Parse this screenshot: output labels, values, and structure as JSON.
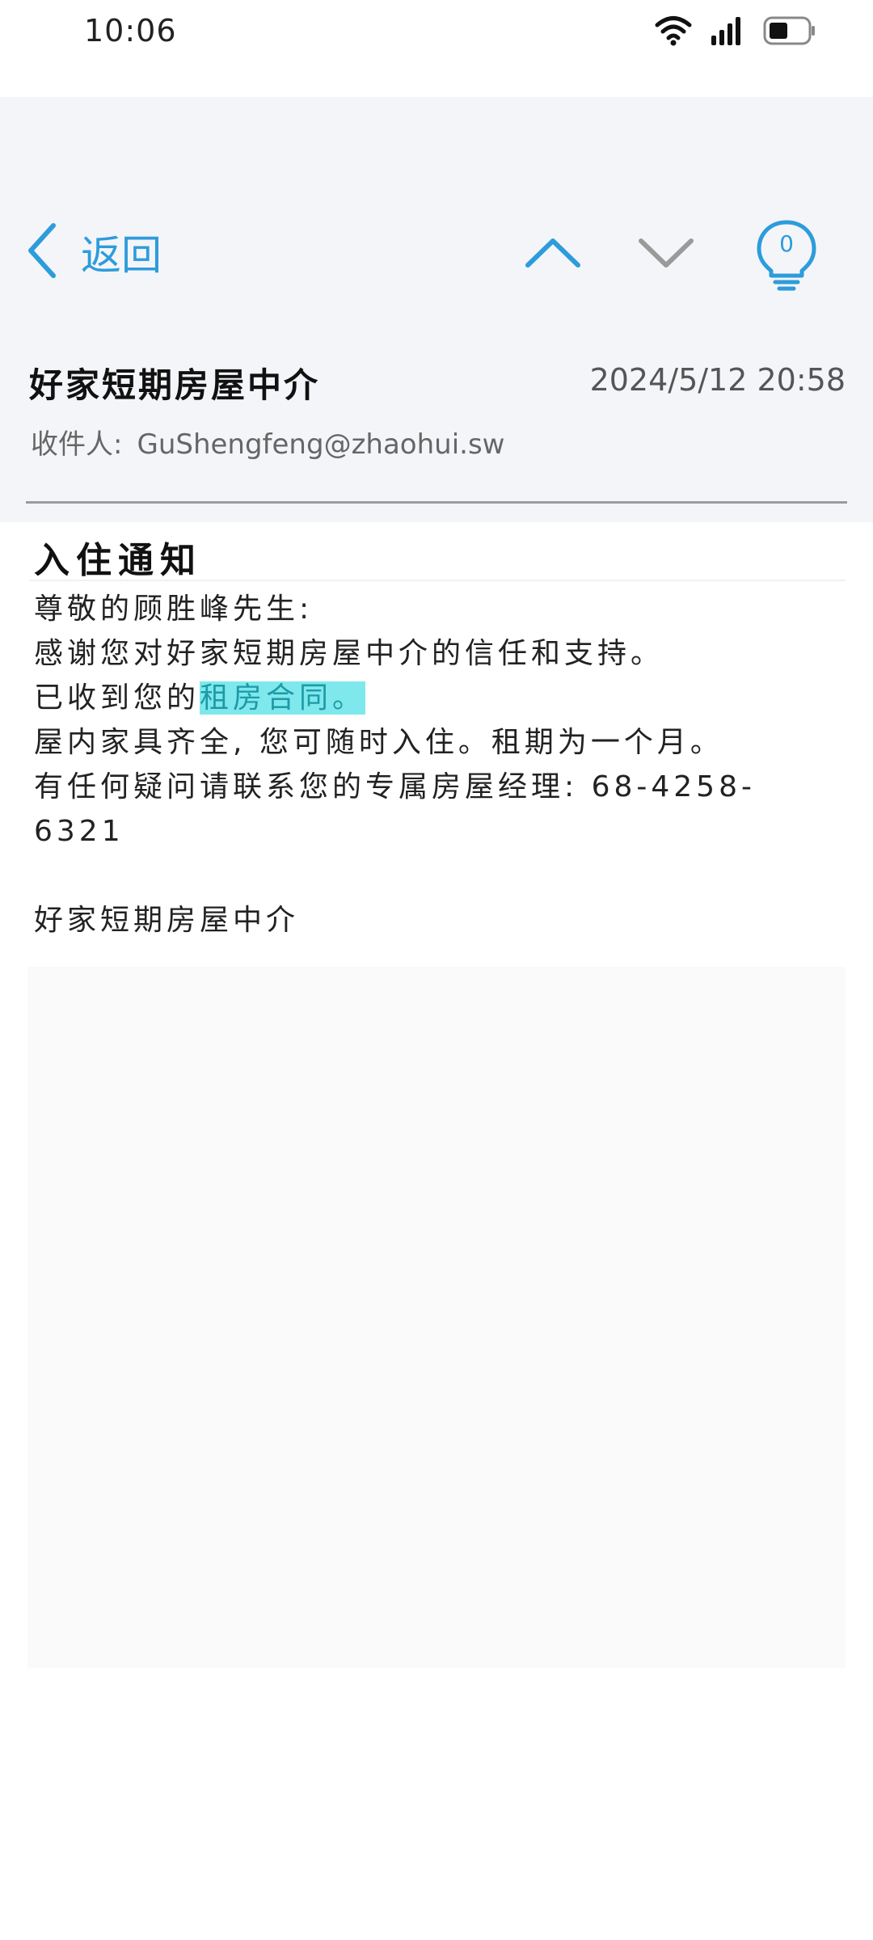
{
  "status_bar": {
    "time": "10:06",
    "icons": [
      "wifi-icon",
      "signal-icon",
      "battery-icon"
    ]
  },
  "nav": {
    "back_label": "返回",
    "hint_count": "0",
    "icons": [
      "back-chevron-icon",
      "up-chevron-icon",
      "down-chevron-icon",
      "lightbulb-icon"
    ]
  },
  "mail": {
    "sender": "好家短期房屋中介",
    "date": "2024/5/12 20:58",
    "recipient_label": "收件人:",
    "recipient": "GuShengfeng@zhaohui.sw",
    "subject": "入住通知",
    "greeting": "尊敬的顾胜峰先生:",
    "line1": "感谢您对好家短期房屋中介的信任和支持。",
    "line2_prefix": "已收到您的",
    "line2_link": "租房合同。",
    "line3": "屋内家具齐全, 您可随时入住。租期为一个月。",
    "line4": "有任何疑问请联系您的专属房屋经理: 68-4258-6321",
    "signature": "好家短期房屋中介"
  },
  "colors": {
    "accent": "#2d9cdb",
    "header_bg": "#f4f5f9",
    "highlight_bg": "#7fe8ec",
    "highlight_text": "#1d9aa6",
    "inactive_icon": "#9a9a9a"
  }
}
